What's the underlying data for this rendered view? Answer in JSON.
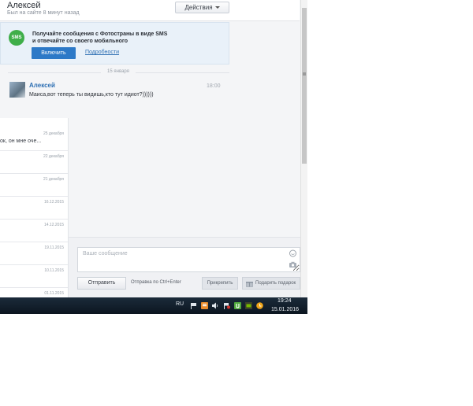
{
  "header": {
    "name": "Алексей",
    "last_seen": "Был на сайте 8 минут назад",
    "actions_label": "Действия"
  },
  "sms_promo": {
    "icon_text": "SMS",
    "text_line1": "Получайте сообщения с Фотостраны в виде SMS",
    "text_line2": "и отвечайте со своего мобильного",
    "enable_label": "Включить",
    "more_label": "Подробности"
  },
  "chat": {
    "date_separator": "15 января",
    "messages": [
      {
        "author": "Алексей",
        "time": "18:00",
        "text": "Маиса,вот теперь ты видишь,кто тут идиот?))))))"
      }
    ]
  },
  "conversations": [
    {
      "date": "25 декабря",
      "preview": "ок, он мне оче..."
    },
    {
      "date": "22 декабря",
      "preview": ""
    },
    {
      "date": "21 декабря",
      "preview": ""
    },
    {
      "date": "16.12.2015",
      "preview": ""
    },
    {
      "date": "14.12.2015",
      "preview": ""
    },
    {
      "date": "19.11.2015",
      "preview": ""
    },
    {
      "date": "10.11.2015",
      "preview": ""
    },
    {
      "date": "01.11.2015",
      "preview": ""
    }
  ],
  "composer": {
    "placeholder": "Ваше сообщение",
    "value": "",
    "send_label": "Отправить",
    "hint": "Отправка по Ctrl+Enter",
    "attach_label": "Прикрепить",
    "gift_label": "Подарить подарок"
  },
  "taskbar": {
    "lang": "RU",
    "time": "19:24",
    "date": "15.01.2016",
    "tray_icons": [
      "flag-icon",
      "app-icon",
      "volume-icon",
      "flag-red-icon",
      "utorrent-icon",
      "nvidia-icon",
      "network-icon",
      "update-icon"
    ]
  },
  "colors": {
    "accent": "#2d79c7",
    "link": "#2d6fb3",
    "sms_green": "#3fae49",
    "taskbar": "#0c1620"
  }
}
